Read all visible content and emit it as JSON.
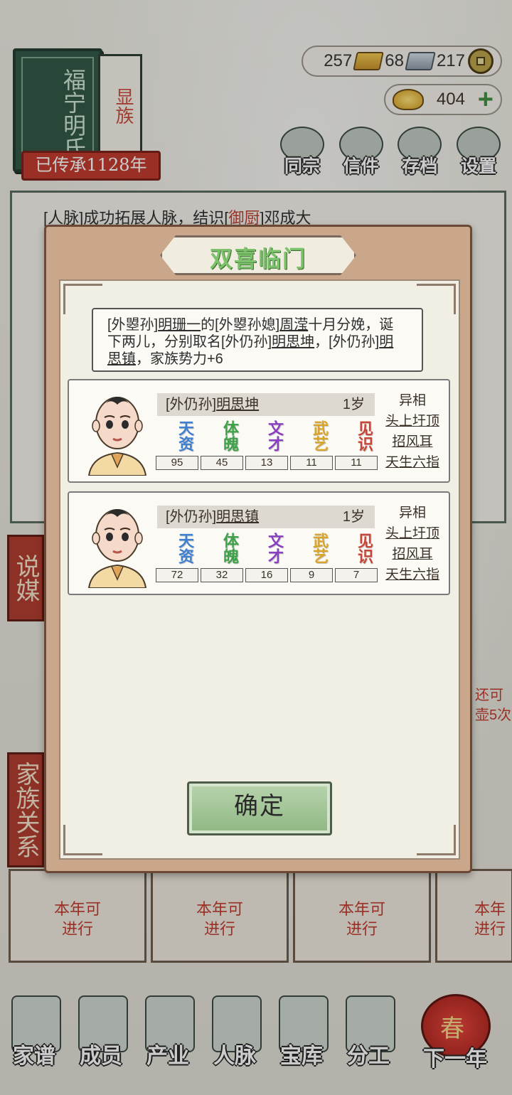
{
  "clan": {
    "name_chars": [
      "福宁",
      "明氏"
    ],
    "tag": "显族",
    "heritage": "已传承1128年"
  },
  "currency": {
    "gold_bars": "257",
    "silver_bars": "68",
    "coins": "217",
    "ingots": "404"
  },
  "top_menu": [
    "同宗",
    "信件",
    "存档",
    "设置"
  ],
  "log": {
    "prefix": "[人脉]成功拓展人脉，结识[",
    "role": "御厨",
    "suffix": "]邓成大"
  },
  "side_tabs": [
    "说媒",
    "家族关系"
  ],
  "right_note": [
    "还可",
    "壶5次"
  ],
  "cards": [
    {
      "line1": "本年可",
      "line2": "进行"
    },
    {
      "line1": "本年可",
      "line2": "进行"
    },
    {
      "line1": "本年可",
      "line2": "进行"
    },
    {
      "line1": "本年",
      "line2": "进行"
    }
  ],
  "bottom_nav": [
    "家谱",
    "成员",
    "产业",
    "人脉",
    "宝库",
    "分工"
  ],
  "next_year": {
    "label": "下一年",
    "lantern": "春"
  },
  "dialog": {
    "title": "双喜临门",
    "message": {
      "p1": "[外曌孙]",
      "n1": "明珊一",
      "p2": "的[外曌孙媳]",
      "n2": "周滢",
      "p3": "十月分娩，诞下两儿，分别取名[外仍孙]",
      "n3": "明思坤",
      "p4": "，[外仍孙]",
      "n4": "明思镇",
      "p5": "，家族势力+6"
    },
    "children": [
      {
        "relation": "[外仍孙]",
        "name": "明思坤",
        "age": "1岁",
        "stat_labels": [
          "天资",
          "体魄",
          "文才",
          "武艺",
          "见识"
        ],
        "stats": [
          "95",
          "45",
          "13",
          "11",
          "11"
        ],
        "traits_title": "异相",
        "traits": [
          "头上圩顶",
          "招风耳",
          "天生六指"
        ]
      },
      {
        "relation": "[外仍孙]",
        "name": "明思镇",
        "age": "1岁",
        "stat_labels": [
          "天资",
          "体魄",
          "文才",
          "武艺",
          "见识"
        ],
        "stats": [
          "72",
          "32",
          "16",
          "9",
          "7"
        ],
        "traits_title": "异相",
        "traits": [
          "头上圩顶",
          "招风耳",
          "天生六指"
        ]
      }
    ],
    "confirm": "确定"
  },
  "colors": {
    "stat_colors": [
      "#3f7fd0",
      "#3fa14a",
      "#8a3fc2",
      "#d8a42a",
      "#c6463a"
    ],
    "title_green": "#7cc26a",
    "accent_red": "#c0392b"
  }
}
